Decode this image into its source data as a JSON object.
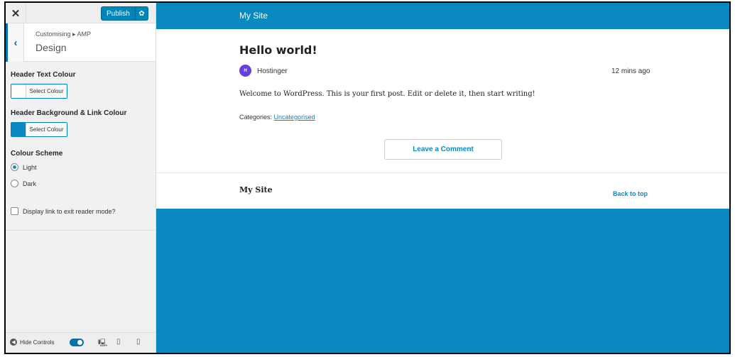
{
  "sidebar": {
    "close_glyph": "✕",
    "publish_label": "Publish",
    "breadcrumb": "Customising ▸ AMP",
    "section_title": "Design",
    "controls": {
      "header_text_colour": {
        "label": "Header Text Colour",
        "button": "Select Colour",
        "swatch": "#ffffff"
      },
      "header_bg_link_colour": {
        "label": "Header Background & Link Colour",
        "button": "Select Colour",
        "swatch": "#0a89c1"
      },
      "colour_scheme": {
        "label": "Colour Scheme",
        "options": [
          "Light",
          "Dark"
        ],
        "selected": "Light"
      },
      "exit_reader_mode": {
        "label": "Display link to exit reader mode?",
        "checked": false
      }
    },
    "footer": {
      "hide_controls_label": "Hide Controls"
    }
  },
  "preview": {
    "site_name": "My Site",
    "post": {
      "title": "Hello world!",
      "avatar_initials": "H",
      "author": "Hostinger",
      "time": "12 mins ago",
      "body": "Welcome to WordPress. This is your first post. Edit or delete it, then start writing!",
      "categories_label": "Categories:",
      "category": "Uncategorised",
      "comment_button": "Leave a Comment"
    },
    "footer": {
      "site_name": "My Site",
      "back_to_top": "Back to top"
    }
  },
  "colors": {
    "accent": "#0a89c1",
    "publish": "#0085ba",
    "avatar": "#673de6"
  }
}
